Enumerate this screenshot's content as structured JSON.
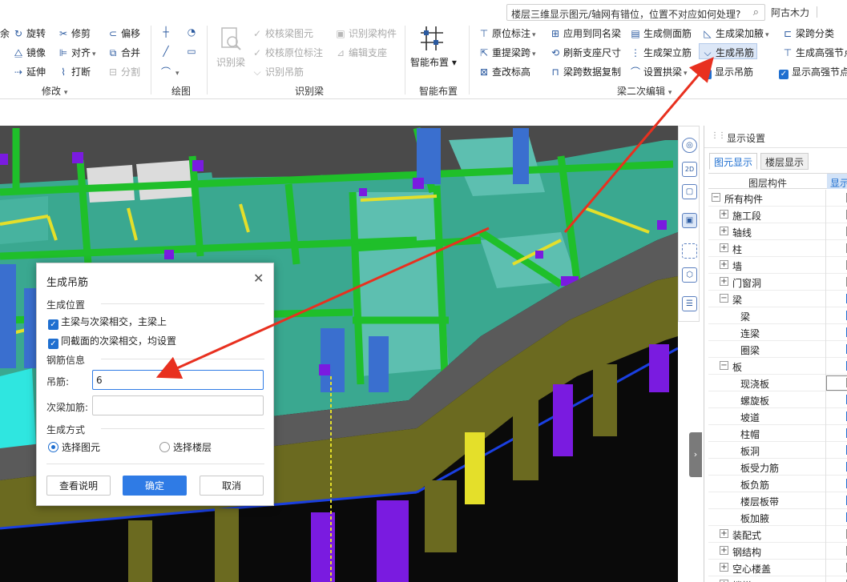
{
  "search": {
    "query": "楼层三维显示图元/轴网有错位，位置不对应如何处理?"
  },
  "user": {
    "name": "阿古木力"
  },
  "ribbon": {
    "modify": {
      "items": [
        "余",
        "旋转",
        "修剪",
        "偏移",
        "镜像",
        "对齐",
        "合并",
        "延伸",
        "打断",
        "分割"
      ],
      "group_label": "修改"
    },
    "draw": {
      "group_label": "绘图"
    },
    "identify_beam": {
      "big_label": "识别梁",
      "items": [
        "校核梁图元",
        "识别梁构件",
        "校核原位标注",
        "编辑支座",
        "识别吊筋"
      ],
      "group_label": "识别梁"
    },
    "smart": {
      "big_label": "智能布置",
      "group_label": "智能布置"
    },
    "secondary": {
      "items": [
        "原位标注",
        "应用到同名梁",
        "生成侧面筋",
        "生成梁加腋",
        "梁跨分类",
        "重提梁跨",
        "刷新支座尺寸",
        "生成架立筋",
        "生成吊筋",
        "生成高强节点",
        "查改标高",
        "梁跨数据复制",
        "设置拱梁",
        "显示吊筋",
        "显示高强节点"
      ],
      "group_label": "梁二次编辑"
    }
  },
  "side_tools": [
    "orbit",
    "2D",
    "cube",
    "view-cube",
    "fit",
    "box",
    "list"
  ],
  "panel": {
    "title": "显示设置",
    "tabs": [
      "图元显示",
      "楼层显示"
    ],
    "col_component": "图层构件",
    "col_show": "显示",
    "rows": [
      {
        "label": "所有构件",
        "level": 0,
        "toggle": "−",
        "checked": false
      },
      {
        "label": "施工段",
        "level": 1,
        "toggle": "+",
        "checked": false
      },
      {
        "label": "轴线",
        "level": 1,
        "toggle": "+",
        "checked": false
      },
      {
        "label": "柱",
        "level": 1,
        "toggle": "+",
        "checked": false
      },
      {
        "label": "墙",
        "level": 1,
        "toggle": "+",
        "checked": false
      },
      {
        "label": "门窗洞",
        "level": 1,
        "toggle": "+",
        "checked": false
      },
      {
        "label": "梁",
        "level": 1,
        "toggle": "−",
        "checked": true
      },
      {
        "label": "梁",
        "level": 2,
        "toggle": "",
        "checked": true
      },
      {
        "label": "连梁",
        "level": 2,
        "toggle": "",
        "checked": true
      },
      {
        "label": "圈梁",
        "level": 2,
        "toggle": "",
        "checked": true
      },
      {
        "label": "板",
        "level": 1,
        "toggle": "−",
        "checked": true
      },
      {
        "label": "现浇板",
        "level": 2,
        "toggle": "",
        "checked": false,
        "boxed": true
      },
      {
        "label": "螺旋板",
        "level": 2,
        "toggle": "",
        "checked": true
      },
      {
        "label": "坡道",
        "level": 2,
        "toggle": "",
        "checked": true
      },
      {
        "label": "柱帽",
        "level": 2,
        "toggle": "",
        "checked": true
      },
      {
        "label": "板洞",
        "level": 2,
        "toggle": "",
        "checked": true
      },
      {
        "label": "板受力筋",
        "level": 2,
        "toggle": "",
        "checked": true
      },
      {
        "label": "板负筋",
        "level": 2,
        "toggle": "",
        "checked": true
      },
      {
        "label": "楼层板带",
        "level": 2,
        "toggle": "",
        "checked": true
      },
      {
        "label": "板加腋",
        "level": 2,
        "toggle": "",
        "checked": true
      },
      {
        "label": "装配式",
        "level": 1,
        "toggle": "+",
        "checked": false
      },
      {
        "label": "钢结构",
        "level": 1,
        "toggle": "+",
        "checked": false
      },
      {
        "label": "空心楼盖",
        "level": 1,
        "toggle": "+",
        "checked": false
      },
      {
        "label": "楼梯",
        "level": 1,
        "toggle": "+",
        "checked": false
      }
    ]
  },
  "dialog": {
    "title": "生成吊筋",
    "section_position": "生成位置",
    "opt_main_secondary": "主梁与次梁相交，主梁上",
    "opt_same_section": "同截面的次梁相交，均设置",
    "section_rebar": "钢筋信息",
    "hanger_label": "吊筋:",
    "hanger_value": "6",
    "secondary_label": "次梁加筋:",
    "secondary_value": "",
    "section_method": "生成方式",
    "radio_select_element": "选择图元",
    "radio_select_floor": "选择楼层",
    "btn_help": "查看说明",
    "btn_ok": "确定",
    "btn_cancel": "取消"
  },
  "colors": {
    "accent": "#2f7be5",
    "slab": "#3aa890",
    "beam": "#1fbf2a",
    "column": "#7a1be0",
    "arrow": "#e8301f"
  }
}
